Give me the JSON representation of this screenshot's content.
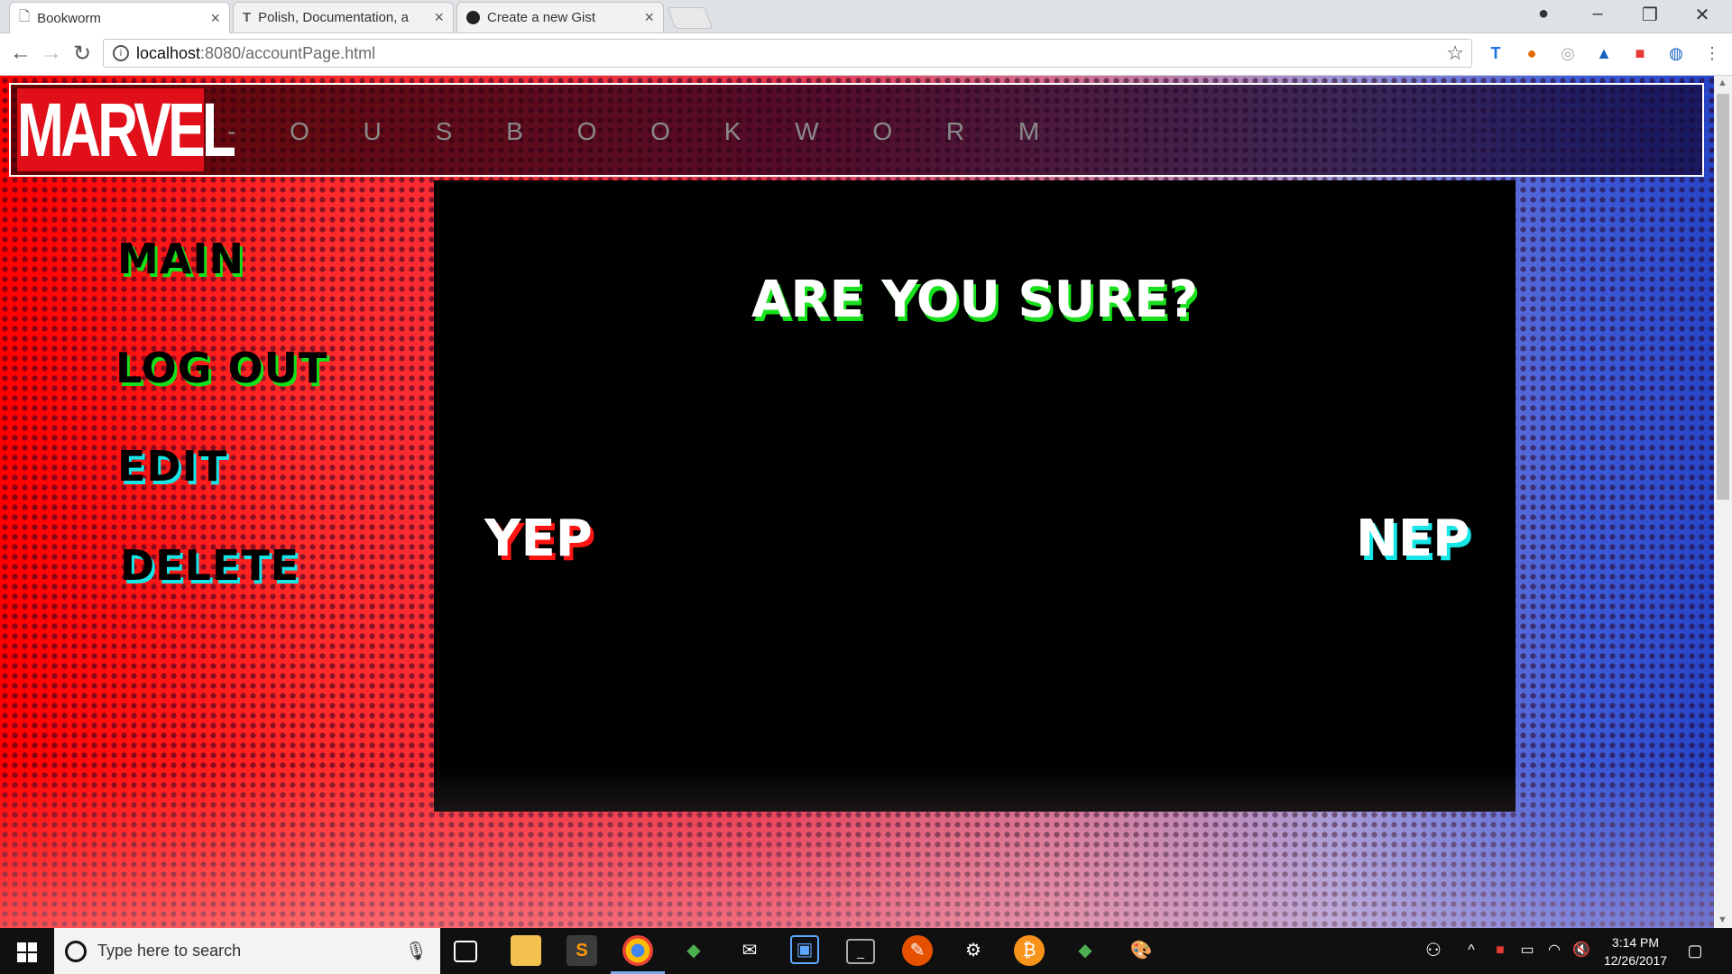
{
  "browser": {
    "tabs": [
      {
        "title": "Bookworm",
        "active": true
      },
      {
        "title": "Polish, Documentation, a",
        "active": false
      },
      {
        "title": "Create a new Gist",
        "active": false
      }
    ],
    "url_host": "localhost",
    "url_path": ":8080/accountPage.html"
  },
  "header": {
    "logo_text": "MARVEL",
    "tagline": "- O U S   B O O K W O R M"
  },
  "sidebar": {
    "items": [
      {
        "label": "MAIN"
      },
      {
        "label": "LOG OUT"
      },
      {
        "label": "EDIT"
      },
      {
        "label": "DELETE"
      }
    ]
  },
  "dialog": {
    "question": "ARE YOU SURE?",
    "confirm_label": "YEP",
    "cancel_label": "NEP"
  },
  "taskbar": {
    "search_placeholder": "Type here to search",
    "time": "3:14 PM",
    "date": "12/26/2017"
  }
}
